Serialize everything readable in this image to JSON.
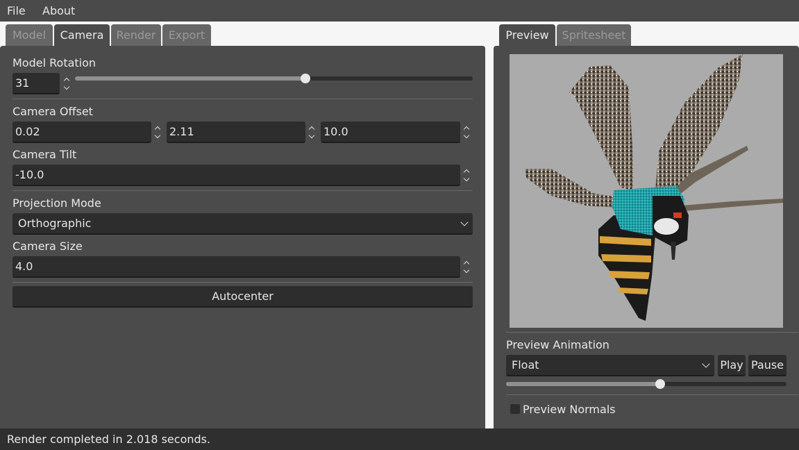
{
  "menu": {
    "items": [
      "File",
      "About"
    ]
  },
  "left_tabs": [
    {
      "label": "Model",
      "active": false
    },
    {
      "label": "Camera",
      "active": true
    },
    {
      "label": "Render",
      "active": false
    },
    {
      "label": "Export",
      "active": false
    }
  ],
  "right_tabs": [
    {
      "label": "Preview",
      "active": true
    },
    {
      "label": "Spritesheet",
      "active": false
    }
  ],
  "camera": {
    "model_rotation_label": "Model Rotation",
    "model_rotation_value": "31",
    "model_rotation_slider_fraction": 0.58,
    "camera_offset_label": "Camera Offset",
    "camera_offset_x": "0.02",
    "camera_offset_y": "2.11",
    "camera_offset_z": "10.0",
    "camera_tilt_label": "Camera Tilt",
    "camera_tilt_value": "-10.0",
    "projection_mode_label": "Projection Mode",
    "projection_mode_value": "Orthographic",
    "camera_size_label": "Camera Size",
    "camera_size_value": "4.0",
    "autocenter_label": "Autocenter"
  },
  "preview": {
    "animation_label": "Preview Animation",
    "animation_value": "Float",
    "play_label": "Play",
    "pause_label": "Pause",
    "animation_slider_fraction": 0.55,
    "normals_label": "Preview Normals",
    "normals_checked": false,
    "subject_icon": "wasp-sprite"
  },
  "status": {
    "text": "Render completed in 2.018 seconds."
  },
  "colors": {
    "viewport_bg": "#ababab",
    "panel_bg": "#4b4b4b",
    "field_bg": "#2d2d2d",
    "wasp_teal": "#1fa3a8",
    "wasp_yellow": "#d8a23a"
  }
}
